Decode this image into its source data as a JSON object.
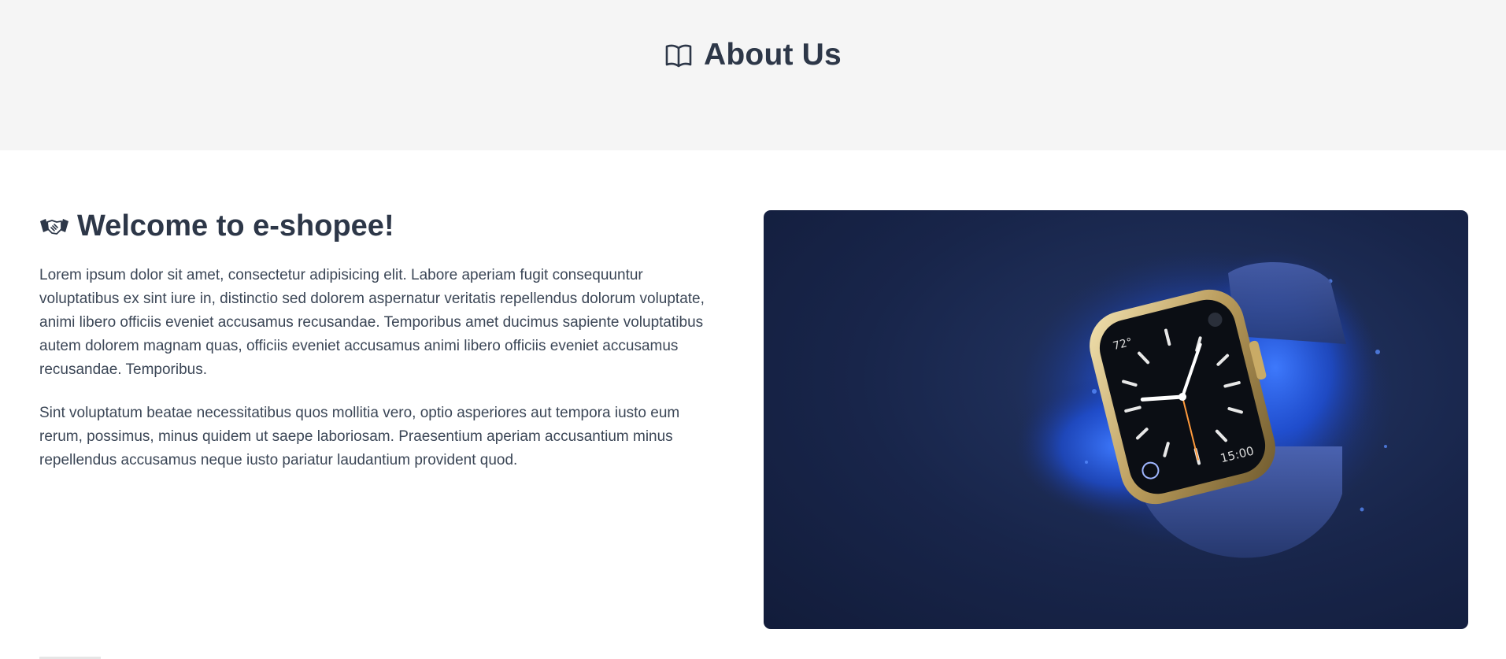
{
  "hero": {
    "title": "About Us",
    "icon": "book-icon"
  },
  "welcome": {
    "icon": "handshake-icon",
    "heading": "Welcome to e-shopee!",
    "paragraphs": [
      "Lorem ipsum dolor sit amet, consectetur adipisicing elit. Labore aperiam fugit consequuntur voluptatibus ex sint iure in, distinctio sed dolorem aspernatur veritatis repellendus dolorum voluptate, animi libero officiis eveniet accusamus recusandae. Temporibus amet ducimus sapiente voluptatibus autem dolorem magnam quas, officiis eveniet accusamus animi libero officiis eveniet accusamus recusandae. Temporibus.",
      "Sint voluptatum beatae necessitatibus quos mollitia vero, optio asperiores aut tempora iusto eum rerum, possimus, minus quidem ut saepe laboriosam. Praesentium aperiam accusantium minus repellendus accusamus neque iusto pariatur laudantium provident quod."
    ]
  },
  "image": {
    "subject": "smartwatch with blue powder explosion",
    "watch": {
      "temp": "72°",
      "time": "15:00"
    }
  },
  "colors": {
    "hero_bg": "#f5f5f5",
    "text": "#2d3748",
    "photo_bg": "#18254a"
  }
}
